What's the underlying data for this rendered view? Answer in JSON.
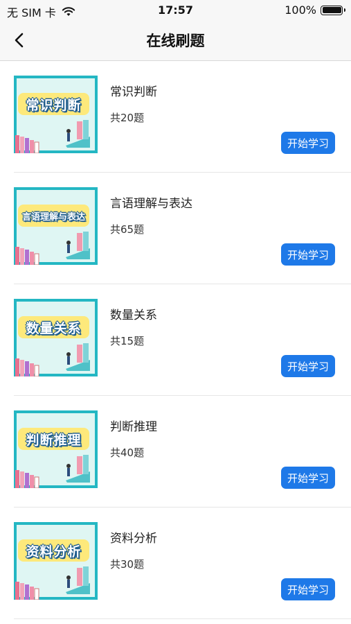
{
  "status_bar": {
    "carrier": "无 SIM 卡",
    "time": "17:57",
    "battery_percent": "100%"
  },
  "nav": {
    "title": "在线刷题",
    "back_icon": "chevron-left-icon"
  },
  "items": [
    {
      "title": "常识判断",
      "cover_text": "常识判断",
      "count": "共20题",
      "button": "开始学习"
    },
    {
      "title": "言语理解与表达",
      "cover_text": "言语理解与表达",
      "count": "共65题",
      "button": "开始学习"
    },
    {
      "title": "数量关系",
      "cover_text": "数量关系",
      "count": "共15题",
      "button": "开始学习"
    },
    {
      "title": "判断推理",
      "cover_text": "判断推理",
      "count": "共40题",
      "button": "开始学习"
    },
    {
      "title": "资料分析",
      "cover_text": "资料分析",
      "count": "共30题",
      "button": "开始学习"
    }
  ],
  "colors": {
    "accent": "#1e79e8",
    "thumb_frame": "#24b7c3",
    "thumb_bg": "#dff6f3",
    "label_band": "#fde97b"
  }
}
